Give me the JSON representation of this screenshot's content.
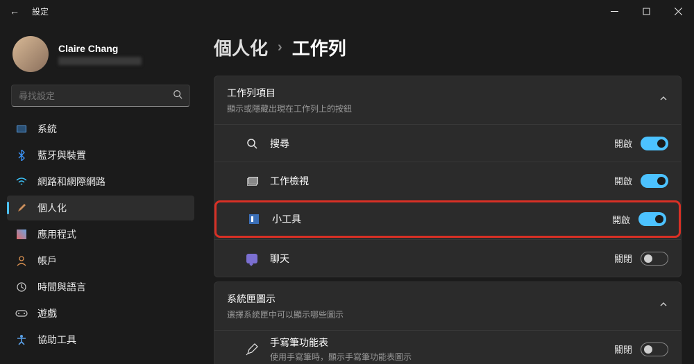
{
  "titlebar": {
    "title": "設定"
  },
  "user": {
    "name": "Claire Chang"
  },
  "search": {
    "placeholder": "尋找設定"
  },
  "nav": [
    {
      "label": "系統"
    },
    {
      "label": "藍牙與裝置"
    },
    {
      "label": "網路和網際網路"
    },
    {
      "label": "個人化"
    },
    {
      "label": "應用程式"
    },
    {
      "label": "帳戶"
    },
    {
      "label": "時間與語言"
    },
    {
      "label": "遊戲"
    },
    {
      "label": "協助工具"
    }
  ],
  "breadcrumb": {
    "parent": "個人化",
    "current": "工作列"
  },
  "section1": {
    "title": "工作列項目",
    "sub": "顯示或隱藏出現在工作列上的按鈕",
    "rows": [
      {
        "label": "搜尋",
        "state": "開啟"
      },
      {
        "label": "工作檢視",
        "state": "開啟"
      },
      {
        "label": "小工具",
        "state": "開啟"
      },
      {
        "label": "聊天",
        "state": "關閉"
      }
    ]
  },
  "section2": {
    "title": "系統匣圖示",
    "sub": "選擇系統匣中可以顯示哪些圖示",
    "rows": [
      {
        "label": "手寫筆功能表",
        "sub": "使用手寫筆時，顯示手寫筆功能表圖示",
        "state": "關閉"
      }
    ]
  }
}
